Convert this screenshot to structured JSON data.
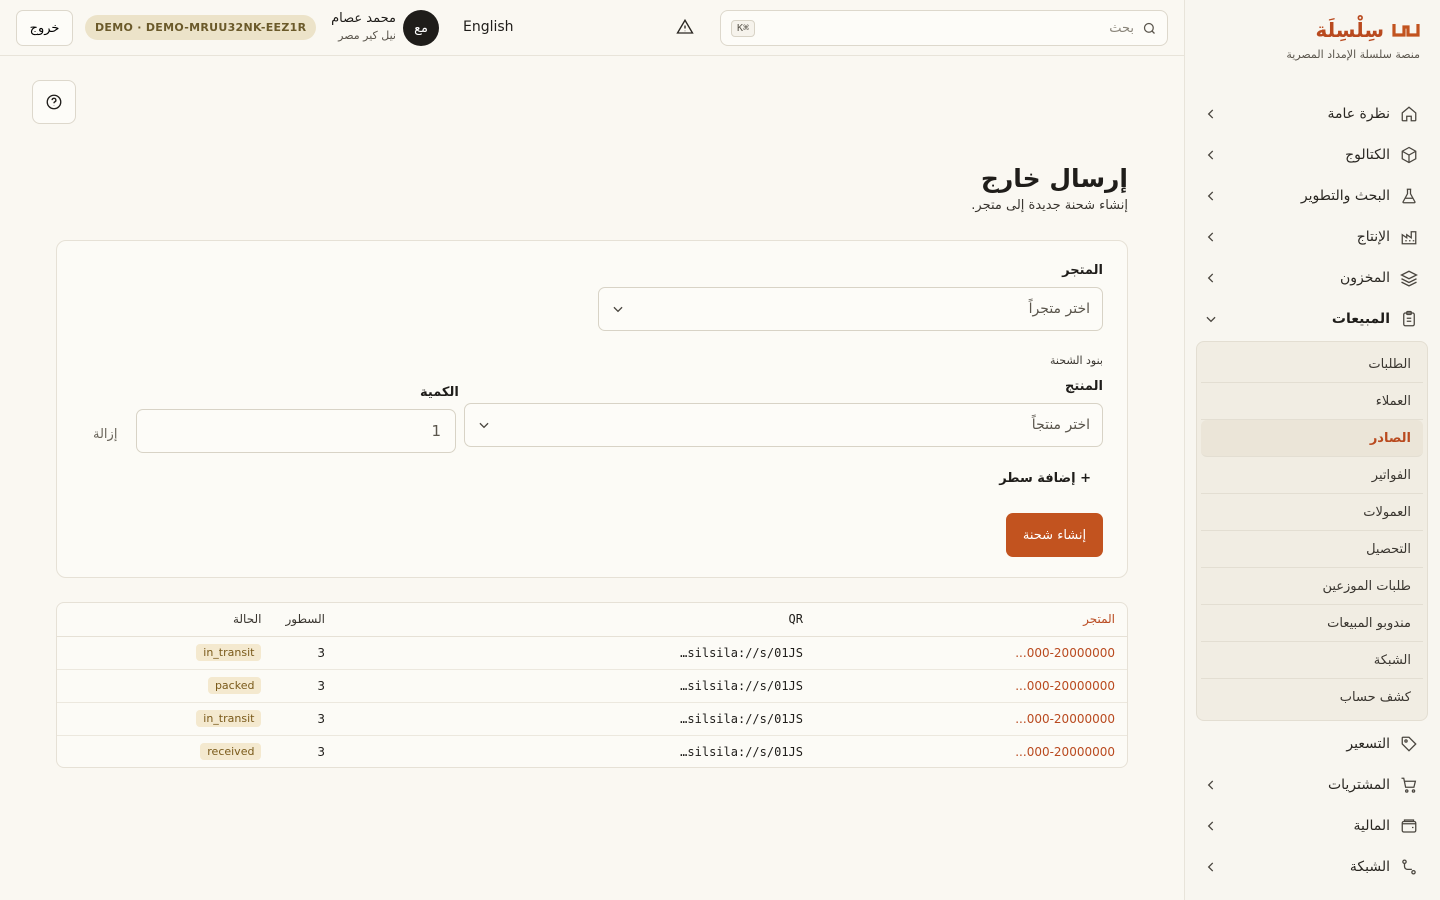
{
  "brand": {
    "name": "سِلْسِلَة",
    "subtitle": "منصة سلسلة الإمداد المصرية",
    "accent": "#c2531f"
  },
  "sidebar": {
    "items": [
      {
        "label": "نظرة عامة",
        "icon": "home-icon",
        "expandable": true
      },
      {
        "label": "الكتالوج",
        "icon": "box-icon",
        "expandable": true
      },
      {
        "label": "البحث والتطوير",
        "icon": "flask-icon",
        "expandable": true
      },
      {
        "label": "الإنتاج",
        "icon": "factory-icon",
        "expandable": true
      },
      {
        "label": "المخزون",
        "icon": "layers-icon",
        "expandable": true
      },
      {
        "label": "المبيعات",
        "icon": "clipboard-icon",
        "expandable": true,
        "open": true
      },
      {
        "label": "التسعير",
        "icon": "tag-icon",
        "expandable": false
      },
      {
        "label": "المشتريات",
        "icon": "cart-icon",
        "expandable": true
      },
      {
        "label": "المالية",
        "icon": "wallet-icon",
        "expandable": true
      },
      {
        "label": "الشبكة",
        "icon": "network-icon",
        "expandable": true
      }
    ],
    "sales_sub": [
      {
        "label": "الطلبات"
      },
      {
        "label": "العملاء"
      },
      {
        "label": "الصادر",
        "active": true
      },
      {
        "label": "الفواتير"
      },
      {
        "label": "العمولات"
      },
      {
        "label": "التحصيل"
      },
      {
        "label": "طلبات الموزعين"
      },
      {
        "label": "مندوبو المبيعات"
      },
      {
        "label": "الشبكة"
      },
      {
        "label": "كشف حساب"
      }
    ]
  },
  "topbar": {
    "search_placeholder": "بحث",
    "search_shortcut": "⌘K",
    "language": "English",
    "avatar_initials": "مع",
    "user_name": "محمد عصام",
    "user_org": "نيل كير مصر",
    "demo_badge": "DEMO · DEMO-MRUU32NK-EEZ1R",
    "logout": "خروج"
  },
  "page": {
    "title": "إرسال خارج",
    "subtitle": "إنشاء شحنة جديدة إلى متجر."
  },
  "form": {
    "store_label": "المتجر",
    "store_placeholder": "اختر متجراً",
    "lines_label": "بنود الشحنة",
    "product_label": "المنتج",
    "product_placeholder": "اختر منتجاً",
    "quantity_label": "الكمية",
    "quantity_value": "1",
    "remove_label": "إزالة",
    "add_line_label": "+ إضافة سطر",
    "submit_label": "إنشاء شحنة"
  },
  "table": {
    "headers": {
      "store": "المتجر",
      "qr": "QR",
      "lines": "السطور",
      "status": "الحالة"
    },
    "rows": [
      {
        "store": "000-20000000...",
        "qr": "silsila://s/01JS…",
        "lines": "3",
        "status": "in_transit"
      },
      {
        "store": "000-20000000...",
        "qr": "silsila://s/01JS…",
        "lines": "3",
        "status": "packed"
      },
      {
        "store": "000-20000000...",
        "qr": "silsila://s/01JS…",
        "lines": "3",
        "status": "in_transit"
      },
      {
        "store": "000-20000000...",
        "qr": "silsila://s/01JS…",
        "lines": "3",
        "status": "received"
      }
    ]
  }
}
